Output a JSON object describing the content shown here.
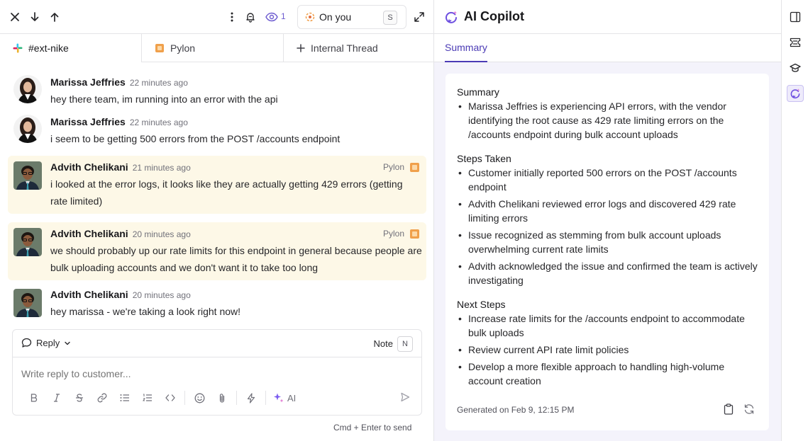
{
  "toolbar": {
    "watch_count": "1",
    "assignee_label": "On you",
    "assignee_shortcut": "S"
  },
  "tabs": [
    {
      "label": "#ext-nike"
    },
    {
      "label": "Pylon"
    },
    {
      "label": "Internal Thread"
    }
  ],
  "messages": [
    {
      "author": "Marissa Jeffries",
      "time": "22 minutes ago",
      "text": "hey there team, im running into an error with the api",
      "source": ""
    },
    {
      "author": "Marissa Jeffries",
      "time": "22 minutes ago",
      "text": "i seem to be getting 500 errors from the POST /accounts endpoint",
      "source": ""
    },
    {
      "author": "Advith Chelikani",
      "time": "21 minutes ago",
      "text": "i looked at the error logs, it looks like they are actually getting 429 errors (getting rate limited)",
      "source": "Pylon"
    },
    {
      "author": "Advith Chelikani",
      "time": "20 minutes ago",
      "text": "we should probably up our rate limits for this endpoint in general because people are bulk uploading accounts and we don't want it to take too long",
      "source": "Pylon"
    },
    {
      "author": "Advith Chelikani",
      "time": "20 minutes ago",
      "text": "hey marissa - we're taking a look right now!",
      "source": ""
    }
  ],
  "composer": {
    "reply_label": "Reply",
    "note_label": "Note",
    "note_shortcut": "N",
    "placeholder": "Write reply to customer...",
    "ai_label": "AI",
    "send_hint": "Cmd + Enter to send"
  },
  "copilot": {
    "title": "AI Copilot",
    "tab_summary": "Summary",
    "sections": [
      {
        "title": "Summary",
        "items": [
          "Marissa Jeffries is experiencing API errors, with the vendor identifying the root cause as 429 rate limiting errors on the /accounts endpoint during bulk account uploads"
        ]
      },
      {
        "title": "Steps Taken",
        "items": [
          "Customer initially reported 500 errors on the POST /accounts endpoint",
          "Advith Chelikani reviewed error logs and discovered 429 rate limiting errors",
          "Issue recognized as stemming from bulk account uploads overwhelming current rate limits",
          "Advith acknowledged the issue and confirmed the team is actively investigating"
        ]
      },
      {
        "title": "Next Steps",
        "items": [
          "Increase rate limits for the /accounts endpoint to accommodate bulk uploads",
          "Review current API rate limit policies",
          "Develop a more flexible approach to handling high-volume account creation"
        ]
      }
    ],
    "generated": "Generated on Feb 9, 12:15 PM"
  },
  "icons": [
    "close-icon",
    "arrow-down-icon",
    "arrow-up-icon",
    "more-vertical-icon",
    "bell-icon",
    "eye-icon",
    "expand-icon",
    "slack-icon",
    "pylon-icon",
    "plus-icon",
    "copilot-icon",
    "clipboard-icon",
    "refresh-icon",
    "sidebar-icon",
    "ticket-icon",
    "graduation-cap-icon"
  ],
  "colors": {
    "accent": "#4b3bb5",
    "highlight": "#fdf8e7",
    "pylon_orange": "#f0a04b"
  }
}
